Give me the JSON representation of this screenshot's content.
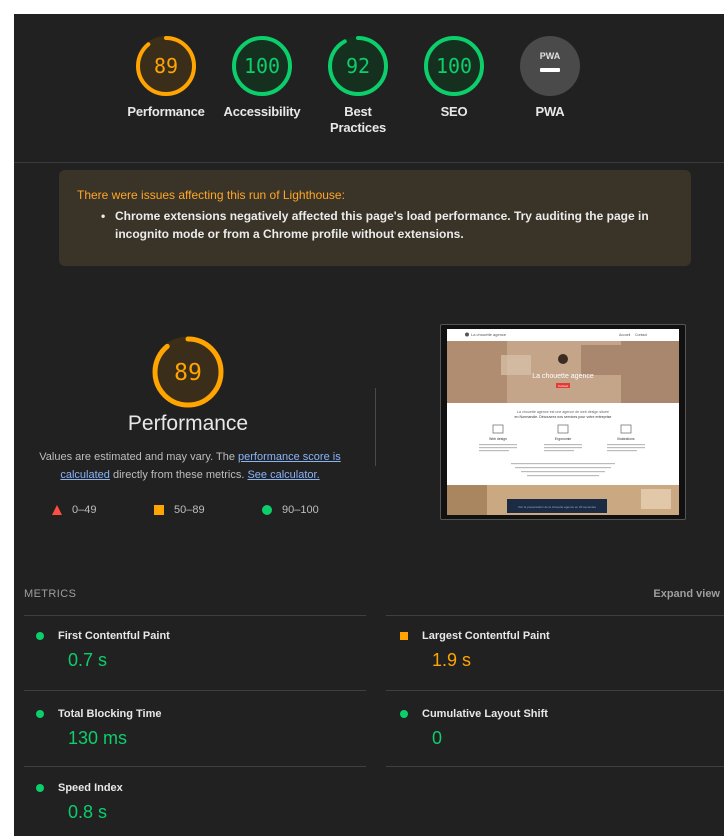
{
  "gauges": [
    {
      "score": "89",
      "label": "Performance",
      "value": 89,
      "color": "#ffa400"
    },
    {
      "score": "100",
      "label": "Accessibility",
      "value": 100,
      "color": "#0cce6b"
    },
    {
      "score": "92",
      "label": "Best Practices",
      "value": 92,
      "color": "#0cce6b"
    },
    {
      "score": "100",
      "label": "SEO",
      "value": 100,
      "color": "#0cce6b"
    },
    {
      "score": "PWA",
      "label": "PWA",
      "value": 0,
      "color": "#9e9e9e"
    }
  ],
  "warning": {
    "title": "There were issues affecting this run of Lighthouse:",
    "bullet": "•",
    "item": "Chrome extensions negatively affected this page's load performance. Try auditing the page in incognito mode or from a Chrome profile without extensions."
  },
  "performance": {
    "score": "89",
    "value": 89,
    "title": "Performance",
    "desc_1": "Values are estimated and may vary. The ",
    "link_score": "performance score is calculated",
    "desc_2": " directly from these metrics. ",
    "link_calc": "See calculator.",
    "legend": [
      {
        "range": "0–49",
        "symbol": "triangle",
        "color": "#ff4e42"
      },
      {
        "range": "50–89",
        "symbol": "square",
        "color": "#ffa400"
      },
      {
        "range": "90–100",
        "symbol": "circle",
        "color": "#0cce6b"
      }
    ]
  },
  "thumbnail": {
    "brand": "La chouette agence",
    "nav_1": "Accueil",
    "nav_2": "Contact",
    "hero": "La chouette agence",
    "cta": "Contact",
    "intro_1": "La chouette agence est une agence de web design située",
    "intro_2": "en Normandie. Découvrez nos services pour votre entreprise",
    "feature_1": "Web design",
    "feature_2": "Ergonomie",
    "feature_3": "Illustrations",
    "footer_banner": "Voir la présentation de la chouette agence en 20 secondes"
  },
  "metrics": {
    "header": "METRICS",
    "expand": "Expand view",
    "items": [
      {
        "name": "First Contentful Paint",
        "value": "0.7 s",
        "status": "good"
      },
      {
        "name": "Largest Contentful Paint",
        "value": "1.9 s",
        "status": "average"
      },
      {
        "name": "Total Blocking Time",
        "value": "130 ms",
        "status": "good"
      },
      {
        "name": "Cumulative Layout Shift",
        "value": "0",
        "status": "good"
      },
      {
        "name": "Speed Index",
        "value": "0.8 s",
        "status": "good"
      }
    ]
  }
}
